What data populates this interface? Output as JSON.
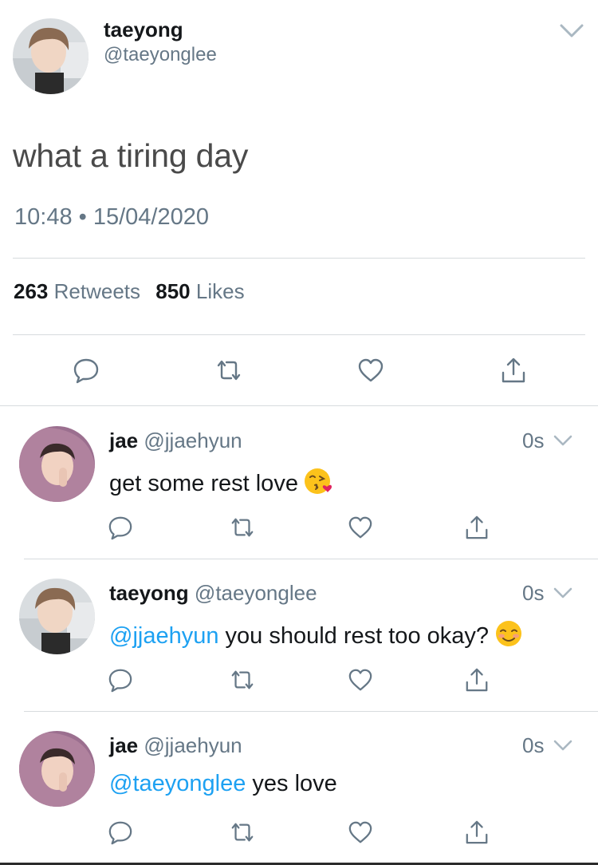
{
  "tweet": {
    "author_name": "taeyong",
    "author_handle": "@taeyonglee",
    "text": "what a tiring day",
    "timestamp": "10:48 • 15/04/2020",
    "retweets_count": "263",
    "retweets_label": "Retweets",
    "likes_count": "850",
    "likes_label": "Likes"
  },
  "replies": [
    {
      "name": "jae",
      "handle": "@jjaehyun",
      "time": "0s",
      "mention": "",
      "text": "get some rest love",
      "emoji": "kissing-face-heart-emoji"
    },
    {
      "name": "taeyong",
      "handle": "@taeyonglee",
      "time": "0s",
      "mention": "@jjaehyun",
      "text": " you should rest too okay?",
      "emoji": "smiling-blush-emoji"
    },
    {
      "name": "jae",
      "handle": "@jjaehyun",
      "time": "0s",
      "mention": "@taeyonglee",
      "text": " yes love",
      "emoji": ""
    }
  ],
  "colors": {
    "mention": "#1da1f2",
    "secondary_text": "#657786",
    "icon": "#657786",
    "divider": "#d7dbde"
  },
  "icons": [
    "chevron-down-icon",
    "reply-icon",
    "retweet-icon",
    "like-icon",
    "share-icon"
  ]
}
